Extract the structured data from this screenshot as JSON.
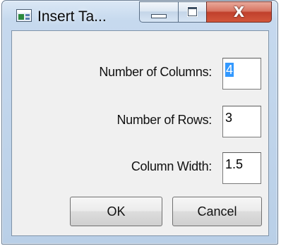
{
  "window": {
    "title": "Insert Ta...",
    "icon": "table-app-icon",
    "close_glyph": "X"
  },
  "form": {
    "columns_label": "Number of Columns:",
    "columns_value": "4",
    "rows_label": "Number of Rows:",
    "rows_value": "3",
    "width_label": "Column Width:",
    "width_value": "1.5"
  },
  "buttons": {
    "ok_label": "OK",
    "cancel_label": "Cancel"
  },
  "colors": {
    "selection": "#3399ff",
    "close_button": "#c0402c",
    "dialog_face": "#f0f0f0"
  }
}
